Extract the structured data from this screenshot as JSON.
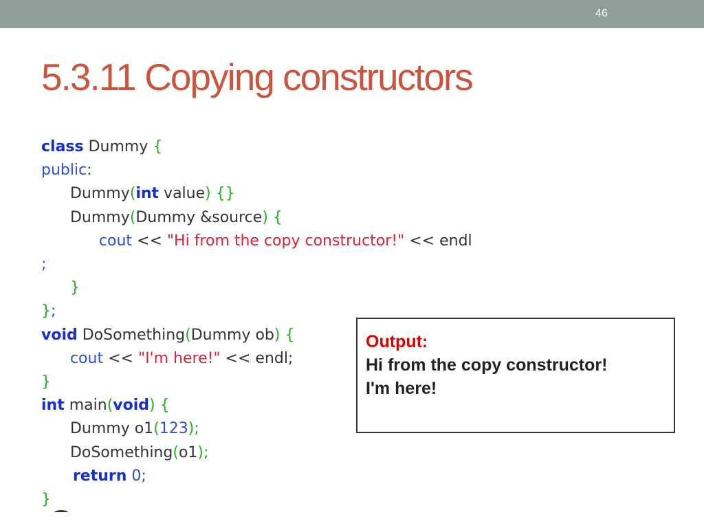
{
  "slide": {
    "number": "46",
    "title": "5.3.11 Copying constructors",
    "colors": {
      "topbar": "#8f9e97",
      "title": "#c9553e",
      "keyword": "#1630c9",
      "bracket": "#21b321",
      "string": "#e0213a",
      "output_label": "#e00000"
    }
  },
  "code": {
    "lines": [
      [
        {
          "t": "class",
          "c": "kw"
        },
        {
          "t": " Dummy ",
          "c": "fn"
        },
        {
          "t": "{",
          "c": "br"
        }
      ],
      [
        {
          "t": "public",
          "c": "id"
        },
        {
          "t": ":",
          "c": "fn"
        }
      ],
      [
        {
          "t": "      Dummy",
          "c": "fn"
        },
        {
          "t": "(",
          "c": "br"
        },
        {
          "t": "int",
          "c": "kw"
        },
        {
          "t": " value",
          "c": "fn"
        },
        {
          "t": ") {}",
          "c": "br"
        }
      ],
      [
        {
          "t": "      Dummy",
          "c": "fn"
        },
        {
          "t": "(",
          "c": "br"
        },
        {
          "t": "Dummy &source",
          "c": "fn"
        },
        {
          "t": ") {",
          "c": "br"
        }
      ],
      [
        {
          "t": "            cout",
          "c": "id"
        },
        {
          "t": " << ",
          "c": "fn"
        },
        {
          "t": "\"Hi from the copy constructor!\"",
          "c": "str"
        },
        {
          "t": " << endl",
          "c": "fn"
        }
      ],
      [
        {
          "t": ";",
          "c": "id"
        }
      ],
      [
        {
          "t": "      }",
          "c": "br"
        }
      ],
      [
        {
          "t": "}",
          "c": "br"
        },
        {
          "t": ";",
          "c": "id"
        }
      ],
      [
        {
          "t": "void",
          "c": "kw"
        },
        {
          "t": " DoSomething",
          "c": "fn"
        },
        {
          "t": "(",
          "c": "br"
        },
        {
          "t": "Dummy ob",
          "c": "fn"
        },
        {
          "t": ") {",
          "c": "br"
        }
      ],
      [
        {
          "t": "      cout",
          "c": "id"
        },
        {
          "t": " << ",
          "c": "fn"
        },
        {
          "t": "\"I'm here!\"",
          "c": "str"
        },
        {
          "t": " << endl;",
          "c": "fn"
        }
      ],
      [
        {
          "t": "}",
          "c": "br"
        }
      ],
      [
        {
          "t": "int",
          "c": "kw"
        },
        {
          "t": " main",
          "c": "fn"
        },
        {
          "t": "(",
          "c": "br"
        },
        {
          "t": "void",
          "c": "kw"
        },
        {
          "t": ") {",
          "c": "br"
        }
      ],
      [
        {
          "t": "      Dummy o1",
          "c": "fn"
        },
        {
          "t": "(",
          "c": "br"
        },
        {
          "t": "123",
          "c": "num"
        },
        {
          "t": ");",
          "c": "br"
        }
      ],
      [
        {
          "t": "      DoSomething",
          "c": "fn"
        },
        {
          "t": "(",
          "c": "br"
        },
        {
          "t": "o1",
          "c": "fn"
        },
        {
          "t": ");",
          "c": "br"
        }
      ],
      [
        {
          "t": "      return",
          "c": "kw"
        },
        {
          "t": " 0",
          "c": "num"
        },
        {
          "t": ";",
          "c": "id"
        }
      ],
      [
        {
          "t": "}",
          "c": "br"
        }
      ]
    ]
  },
  "output": {
    "label": "Output:",
    "lines": [
      "Hi from the copy constructor!",
      "I'm here!"
    ]
  }
}
